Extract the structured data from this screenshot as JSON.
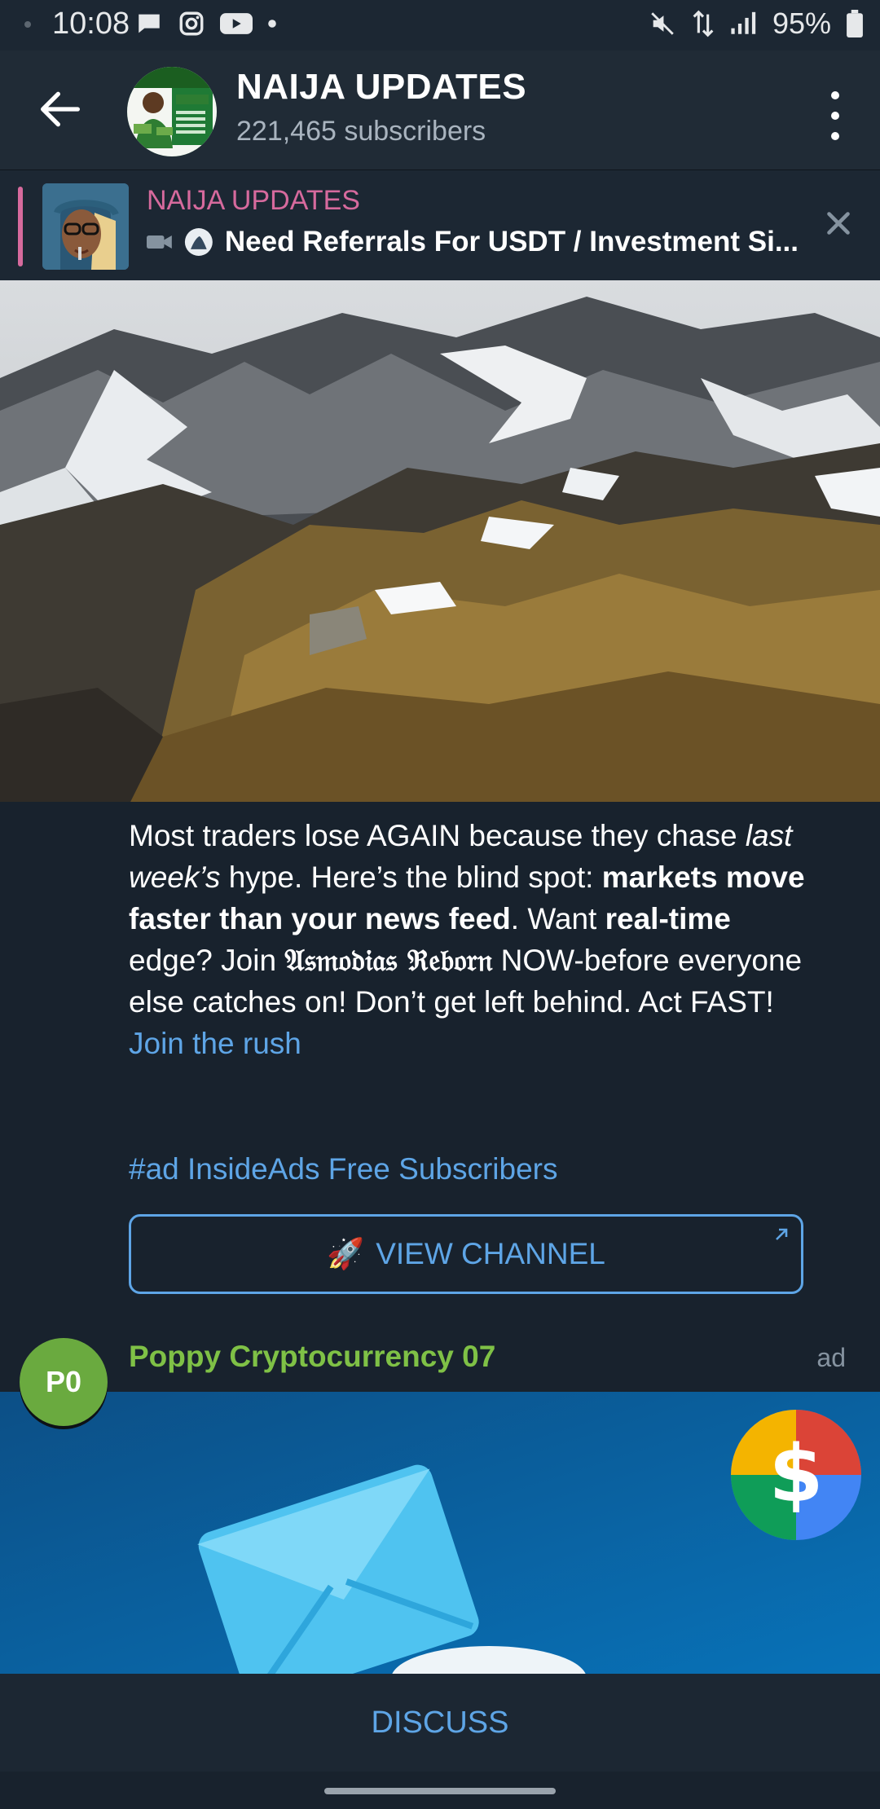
{
  "status_bar": {
    "time": "10:08",
    "battery": "95%"
  },
  "header": {
    "title": "NAIJA UPDATES",
    "subscribers": "221,465 subscribers"
  },
  "pinned": {
    "title": "NAIJA UPDATES",
    "text": "Need Referrals For USDT / Investment Si..."
  },
  "post": {
    "text_1": "Most traders lose AGAIN because they chase ",
    "text_italic": "last week’s",
    "text_2": " hype. Here’s the blind spot: ",
    "text_bold_1": "markets move faster than your news feed",
    "text_3": ". Want ",
    "text_bold_2": "real-time",
    "text_4": " edge? Join ",
    "text_gothic": "𝔄𝔰𝔪𝔬𝔡𝔦𝔞𝔰 ℜ𝔢𝔟𝔬𝔯𝔫",
    "text_5": " NOW-before everyone else catches on! Don’t get left behind. Act FAST!",
    "link": "Join the rush",
    "hashtag": "#ad InsideAds Free Subscribers",
    "button_label": "VIEW CHANNEL",
    "button_emoji": "🚀"
  },
  "ad": {
    "avatar_initials": "P0",
    "name": "Poppy Cryptocurrency 07",
    "label": "ad"
  },
  "footer": {
    "discuss_label": "DISCUSS"
  },
  "colors": {
    "accent": "#5ea5e6",
    "pin_pink": "#d66a9d",
    "ad_green": "#7fc146",
    "bg": "#18222d"
  }
}
